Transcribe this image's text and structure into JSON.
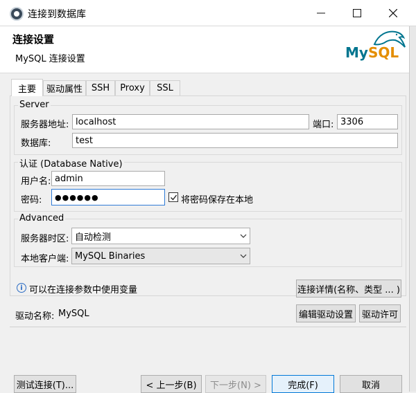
{
  "window": {
    "title": "连接到数据库"
  },
  "header": {
    "title": "连接设置",
    "subtitle": "MySQL 连接设置",
    "logo_my": "My",
    "logo_sql": "SQL"
  },
  "tabs": [
    {
      "label": "主要",
      "active": true
    },
    {
      "label": "驱动属性",
      "active": false
    },
    {
      "label": "SSH",
      "active": false
    },
    {
      "label": "Proxy",
      "active": false
    },
    {
      "label": "SSL",
      "active": false
    }
  ],
  "server": {
    "group_label": "Server",
    "host_label": "服务器地址:",
    "host_value": "localhost",
    "port_label": "端口:",
    "port_value": "3306",
    "db_label": "数据库:",
    "db_value": "test"
  },
  "auth": {
    "group_label": "认证 (Database Native)",
    "user_label": "用户名:",
    "user_value": "admin",
    "pass_label": "密码:",
    "pass_value": "●●●●●●",
    "save_label": "将密码保存在本地",
    "save_checked": true
  },
  "advanced": {
    "group_label": "Advanced",
    "tz_label": "服务器时区:",
    "tz_value": "自动检测",
    "client_label": "本地客户端:",
    "client_value": "MySQL Binaries"
  },
  "info": {
    "text": "可以在连接参数中使用变量",
    "details_button": "连接详情(名称、类型 ... )"
  },
  "driver": {
    "name_label": "驱动名称:",
    "name_value": "MySQL",
    "edit_button": "编辑驱动设置",
    "license_button": "驱动许可"
  },
  "footer": {
    "test_button": "测试连接(T)...",
    "back_button": "< 上一步(B)",
    "next_button": "下一步(N) >",
    "finish_button": "完成(F)",
    "cancel_button": "取消"
  },
  "colors": {
    "focus_border": "#2f7bd7",
    "logo_blue": "#00758f",
    "logo_orange": "#e48e00"
  }
}
